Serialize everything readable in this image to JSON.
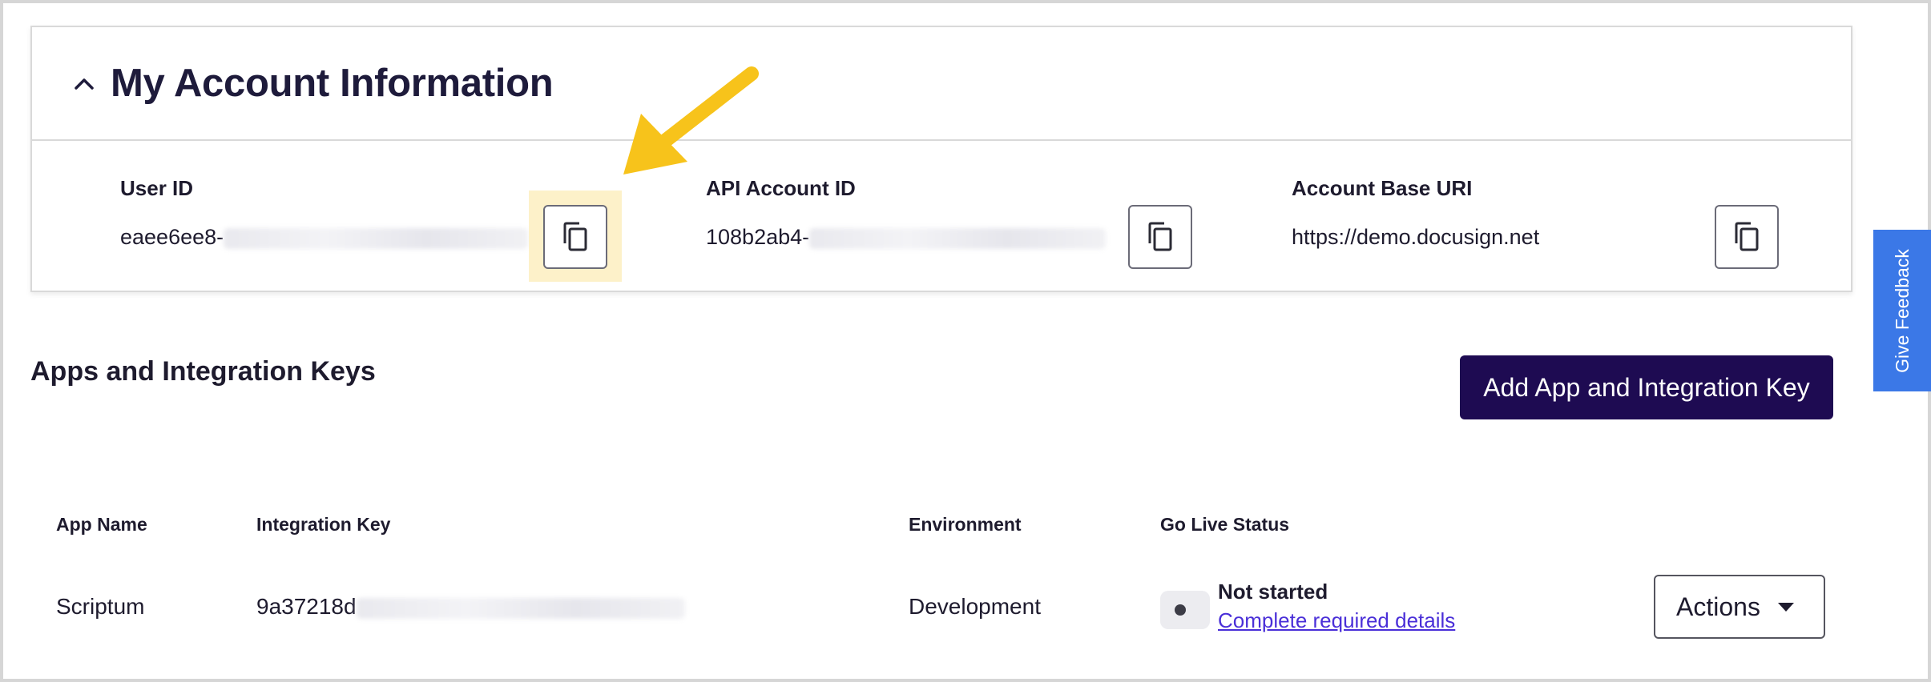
{
  "account": {
    "title": "My Account Information",
    "fields": [
      {
        "label": "User ID",
        "value_visible": "eaee6ee8-",
        "copy_icon": "copy-icon"
      },
      {
        "label": "API Account ID",
        "value_visible": "108b2ab4-",
        "copy_icon": "copy-icon"
      },
      {
        "label": "Account Base URI",
        "value_visible": "https://demo.docusign.net",
        "copy_icon": "copy-icon"
      }
    ]
  },
  "apps": {
    "title": "Apps and Integration Keys",
    "add_button": "Add App and Integration Key",
    "columns": [
      "App Name",
      "Integration Key",
      "Environment",
      "Go Live Status"
    ],
    "rows": [
      {
        "app_name": "Scriptum",
        "integration_key_visible": "9a37218d",
        "environment": "Development",
        "status": "Not started",
        "status_link": "Complete required details",
        "actions_label": "Actions"
      }
    ]
  },
  "feedback": {
    "label": "Give Feedback"
  },
  "colors": {
    "primary_button": "#1e0b52",
    "feedback_tab": "#3b78e7",
    "highlight": "#fdf1c9",
    "arrow": "#f7c31b",
    "link": "#4a2fd8"
  }
}
